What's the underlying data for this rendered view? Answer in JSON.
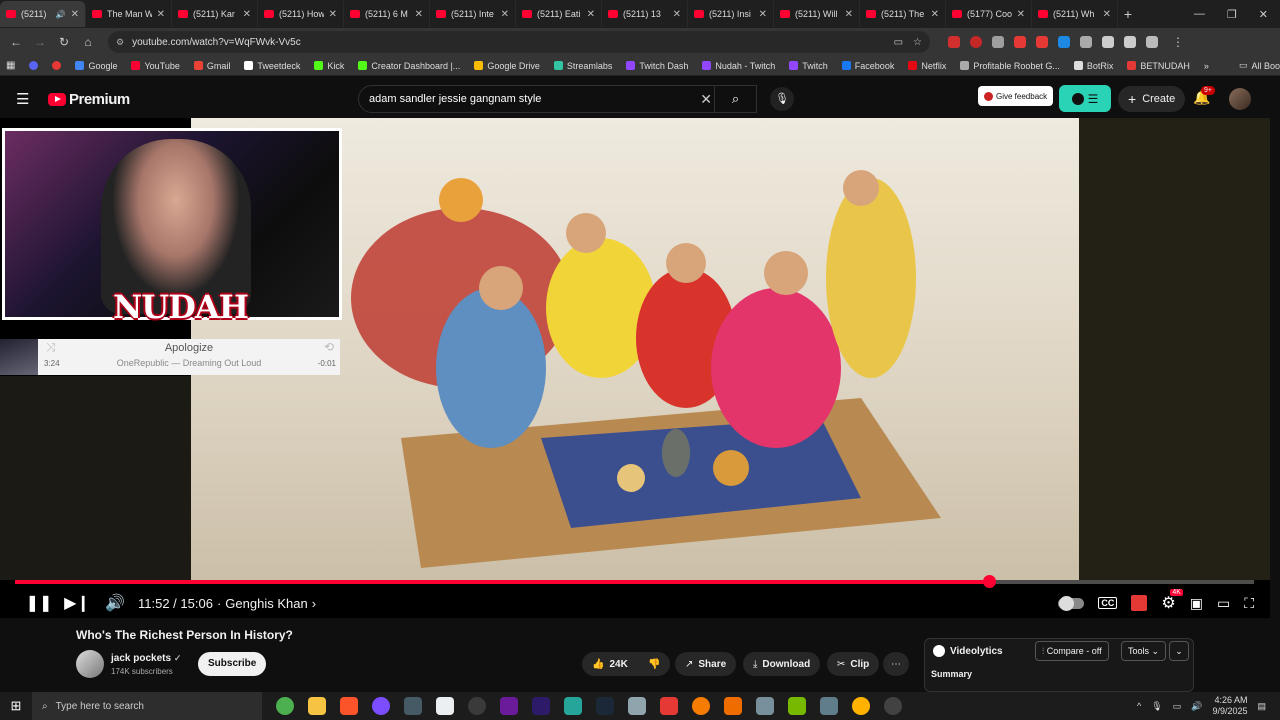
{
  "browser": {
    "tabs": [
      {
        "label": "(5211)",
        "active": true
      },
      {
        "label": "The Man W"
      },
      {
        "label": "(5211) Kar"
      },
      {
        "label": "(5211) How"
      },
      {
        "label": "(5211) 6 M"
      },
      {
        "label": "(5211) Inte"
      },
      {
        "label": "(5211) Eati"
      },
      {
        "label": "(5211) 13"
      },
      {
        "label": "(5211) Insi"
      },
      {
        "label": "(5211) Will"
      },
      {
        "label": "(5211) The"
      },
      {
        "label": "(5177) Coo"
      },
      {
        "label": "(5211) Wh"
      }
    ],
    "new_tab": "+",
    "url": "youtube.com/watch?v=WqFWvk-Vv5c",
    "bookmarks": [
      {
        "label": "Google",
        "color": "#4285f4"
      },
      {
        "label": "YouTube",
        "color": "#ff0033"
      },
      {
        "label": "Gmail",
        "color": "#ea4335"
      },
      {
        "label": "Tweetdeck",
        "color": "#ffffff"
      },
      {
        "label": "Kick",
        "color": "#53fc18"
      },
      {
        "label": "Creator Dashboard |...",
        "color": "#53fc18"
      },
      {
        "label": "Google Drive",
        "color": "#fbbc04"
      },
      {
        "label": "Streamlabs",
        "color": "#31c3a2"
      },
      {
        "label": "Twitch Dash",
        "color": "#9146ff"
      },
      {
        "label": "Nudah - Twitch",
        "color": "#9146ff"
      },
      {
        "label": "Twitch",
        "color": "#9146ff"
      },
      {
        "label": "Facebook",
        "color": "#1877f2"
      },
      {
        "label": "Netflix",
        "color": "#e50914"
      },
      {
        "label": "Profitable Roobet G...",
        "color": "#aaaaaa"
      },
      {
        "label": "BotRix",
        "color": "#dddddd"
      },
      {
        "label": "BETNUDAH",
        "color": "#e53935"
      }
    ],
    "all_bookmarks": "All Bookmarks"
  },
  "youtube": {
    "logo_text": "Premium",
    "search_value": "adam sandler jessie gangnam style",
    "give_feedback": "Give feedback",
    "create": "Create",
    "notifications": "9+"
  },
  "overlay": {
    "brand": "NUDAH",
    "song_title": "Apologize",
    "song_artist": "OneRepublic — Dreaming Out Loud",
    "song_length": "3:24",
    "song_remaining": "-0:01"
  },
  "player": {
    "time": "11:52 / 15:06",
    "chapter": "Genghis Khan",
    "progress": 0.786,
    "quality_badge": "4K"
  },
  "video": {
    "title": "Who's The Richest Person In History?",
    "channel": "jack pockets",
    "subscribers": "174K subscribers",
    "subscribe": "Subscribe",
    "likes": "24K",
    "share": "Share",
    "download": "Download",
    "clip": "Clip"
  },
  "videolytics": {
    "title": "Videolytics",
    "compare": "Compare - off",
    "tools": "Tools",
    "summary": "Summary"
  },
  "taskbar": {
    "search_placeholder": "Type here to search",
    "time": "4:26 AM",
    "date": "9/9/2025"
  }
}
